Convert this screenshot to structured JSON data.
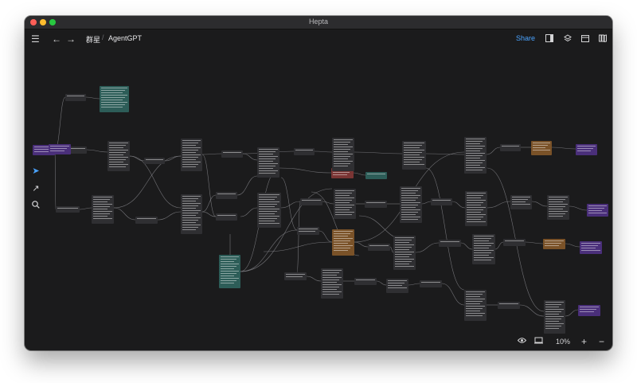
{
  "window": {
    "title": "Hepta"
  },
  "toolbar": {
    "breadcrumb": [
      "群星",
      "AgentGPT"
    ],
    "share_label": "Share",
    "icons": [
      "menu-icon",
      "back-arrow-icon",
      "forward-arrow-icon",
      "sidebar-toggle-icon",
      "layers-icon",
      "calendar-icon",
      "library-icon"
    ]
  },
  "left_tools": {
    "icons": [
      "select-pointer-icon",
      "arrow-connector-icon",
      "search-icon"
    ]
  },
  "bottom_bar": {
    "zoom": "10%",
    "zoom_in": "+",
    "zoom_out": "−"
  },
  "colors": {
    "canvas_bg": "#1b1b1c",
    "card_default": "#2f2f32",
    "card_purple": "#4a2f7a",
    "card_teal": "#2d5d58",
    "card_brown": "#7a5228",
    "card_red": "#7a3534",
    "edge": "#8a8a8e",
    "accent": "#4aa3ff"
  }
}
